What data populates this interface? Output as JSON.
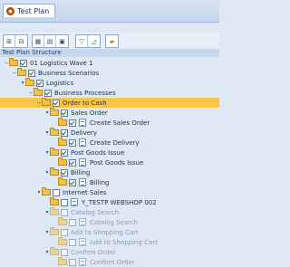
{
  "title_tab": "Test Plan",
  "tree_header": "Test Plan Structure",
  "tree": [
    {
      "label": "01 Logistics Wave 1",
      "expander": "−",
      "check": true,
      "indent": 0,
      "doc": false
    },
    {
      "label": "Business Scenarios",
      "expander": "−",
      "check": true,
      "indent": 1,
      "doc": false
    },
    {
      "label": "Logistics",
      "expander": "▾",
      "check": true,
      "indent": 2,
      "doc": false
    },
    {
      "label": "Business Processes",
      "expander": "−",
      "check": true,
      "indent": 3,
      "doc": false
    },
    {
      "label": "Order to Cash",
      "expander": "−",
      "check": true,
      "indent": 4,
      "doc": false,
      "selected": true
    },
    {
      "label": "Sales Order",
      "expander": "▾",
      "check": true,
      "indent": 5,
      "doc": false
    },
    {
      "label": "Create Sales Order",
      "expander": "",
      "check": true,
      "indent": 6,
      "doc": true
    },
    {
      "label": "Delivery",
      "expander": "▾",
      "check": true,
      "indent": 5,
      "doc": false
    },
    {
      "label": "Create Delivery",
      "expander": "",
      "check": true,
      "indent": 6,
      "doc": true
    },
    {
      "label": "Post Goods Issue",
      "expander": "▾",
      "check": true,
      "indent": 5,
      "doc": false
    },
    {
      "label": "Post Goods Issue",
      "expander": "",
      "check": true,
      "indent": 6,
      "doc": true
    },
    {
      "label": "Billing",
      "expander": "▾",
      "check": true,
      "indent": 5,
      "doc": false
    },
    {
      "label": "Billing",
      "expander": "",
      "check": true,
      "indent": 6,
      "doc": true
    },
    {
      "label": "Internet Sales",
      "expander": "▾",
      "check": false,
      "indent": 4,
      "doc": false
    },
    {
      "label": "Y_TESTP WEBSHOP 002",
      "expander": "",
      "check": false,
      "indent": 5,
      "doc": true
    },
    {
      "label": "Catalog Search",
      "expander": "▾",
      "check": false,
      "indent": 5,
      "doc": false,
      "dim": true
    },
    {
      "label": "Catalog Search",
      "expander": "",
      "check": false,
      "indent": 6,
      "doc": true,
      "dim": true
    },
    {
      "label": "Add to Shopping Cart",
      "expander": "▾",
      "check": false,
      "indent": 5,
      "doc": false,
      "dim": true
    },
    {
      "label": "Add to Shopping Cart",
      "expander": "",
      "check": false,
      "indent": 6,
      "doc": true,
      "dim": true
    },
    {
      "label": "Confirm Order",
      "expander": "▾",
      "check": false,
      "indent": 5,
      "doc": false,
      "dim": true
    },
    {
      "label": "Confirm Order",
      "expander": "",
      "check": false,
      "indent": 6,
      "doc": true,
      "dim": true
    }
  ],
  "toolbar": {
    "group1": [
      "⊞",
      "⊟",
      "◱"
    ],
    "group2": [
      "⊞",
      "⊟",
      "⊡"
    ],
    "group3": [
      "▽",
      "⊿",
      "📁"
    ]
  }
}
